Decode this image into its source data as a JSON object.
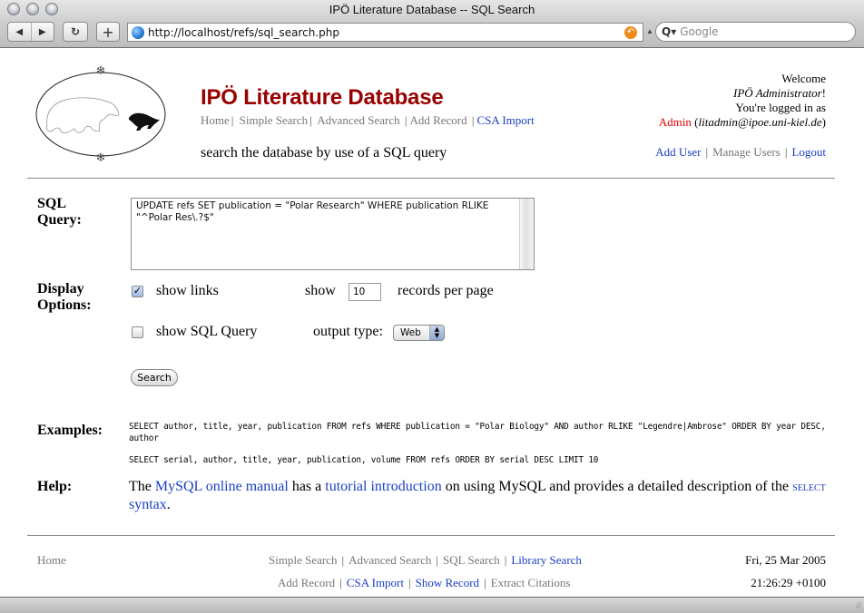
{
  "browser": {
    "window_title": "IPÖ Literature Database -- SQL Search",
    "back_icon": "◀",
    "forward_icon": "▶",
    "reload_icon": "↻",
    "add_icon": "+",
    "url": "http://localhost/refs/sql_search.php",
    "snapback_icon": "↶",
    "search_icon": "Q▾",
    "search_placeholder": "Google"
  },
  "header": {
    "site_title": "IPÖ Literature Database",
    "nav": [
      {
        "label": "Home",
        "style": "grey"
      },
      {
        "label": "Simple Search",
        "style": "grey"
      },
      {
        "label": "Advanced Search",
        "style": "grey"
      },
      {
        "label": "Add Record",
        "style": "grey"
      },
      {
        "label": "CSA Import",
        "style": "link"
      }
    ],
    "separator": "|",
    "subtitle": "search the database by use of a SQL query",
    "welcome": {
      "line1": "Welcome",
      "user_name": "IPÖ Administrator",
      "exclaim": "!",
      "line3": "You're logged in as",
      "role": "Admin",
      "email_open": " (",
      "email": "litadmin@ipoe.uni-kiel.de",
      "email_close": ")"
    },
    "user_nav": [
      {
        "label": "Add User",
        "style": "link"
      },
      {
        "label": "Manage Users",
        "style": "grey"
      },
      {
        "label": "Logout",
        "style": "link"
      }
    ]
  },
  "form": {
    "sql_label_1": "SQL",
    "sql_label_2": "Query:",
    "sql_query": "UPDATE refs SET publication = \"Polar Research\" WHERE publication RLIKE \"^Polar Res\\.?$\"",
    "display_label_1": "Display",
    "display_label_2": "Options:",
    "show_links_label": "show links",
    "show_links_checked": true,
    "show_label": "show",
    "records_per_page": "10",
    "records_per_page_label": "records per page",
    "show_sql_label": "show SQL Query",
    "show_sql_checked": false,
    "output_type_label": "output type:",
    "output_type_value": "Web",
    "check_mark": "✓",
    "select_arrows": "▲▼",
    "search_button": "Search"
  },
  "examples": {
    "label": "Examples:",
    "items": [
      "SELECT author, title, year, publication FROM refs WHERE publication = \"Polar Biology\" AND author RLIKE \"Legendre|Ambrose\" ORDER BY year DESC, author",
      "SELECT serial, author, title, year, publication, volume FROM refs ORDER BY serial DESC LIMIT 10"
    ]
  },
  "help": {
    "label": "Help:",
    "t1": "The ",
    "link1": "MySQL online manual",
    "t2": " has a ",
    "link2": "tutorial introduction",
    "t3": " on using MySQL and provides a detailed description of the ",
    "link3a": "SELECT",
    "link3b": "syntax",
    "t4": "."
  },
  "footer": {
    "home": "Home",
    "row1": [
      {
        "label": "Simple Search",
        "style": "grey"
      },
      {
        "label": "Advanced Search",
        "style": "grey"
      },
      {
        "label": "SQL Search",
        "style": "grey"
      },
      {
        "label": "Library Search",
        "style": "link"
      }
    ],
    "row2": [
      {
        "label": "Add Record",
        "style": "grey"
      },
      {
        "label": "CSA Import",
        "style": "link"
      },
      {
        "label": "Show Record",
        "style": "link"
      },
      {
        "label": "Extract Citations",
        "style": "grey"
      }
    ],
    "date": "Fri, 25 Mar 2005",
    "time": "21:26:29 +0100"
  }
}
